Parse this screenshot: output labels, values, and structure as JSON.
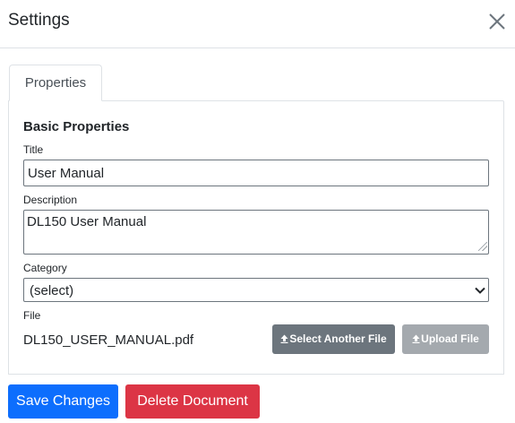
{
  "dialog": {
    "title": "Settings"
  },
  "tabs": [
    {
      "label": "Properties"
    }
  ],
  "form": {
    "section_title": "Basic Properties",
    "title_label": "Title",
    "title_value": "User Manual",
    "description_label": "Description",
    "description_value": "DL150 User Manual",
    "category_label": "Category",
    "category_value": "(select)",
    "file_label": "File",
    "file_name": "DL150_USER_MANUAL.pdf",
    "select_file_label": "Select Another File",
    "upload_file_label": "Upload File"
  },
  "footer": {
    "save_label": "Save Changes",
    "delete_label": "Delete Document"
  },
  "colors": {
    "primary": "#0d6efd",
    "danger": "#dc3545",
    "secondary": "#6c757d",
    "secondary_disabled": "#a4a9ae"
  },
  "icons": {
    "close": "close-icon",
    "select_file": "upload-icon",
    "upload_file": "upload-icon",
    "category_dropdown": "chevron-down-icon"
  }
}
